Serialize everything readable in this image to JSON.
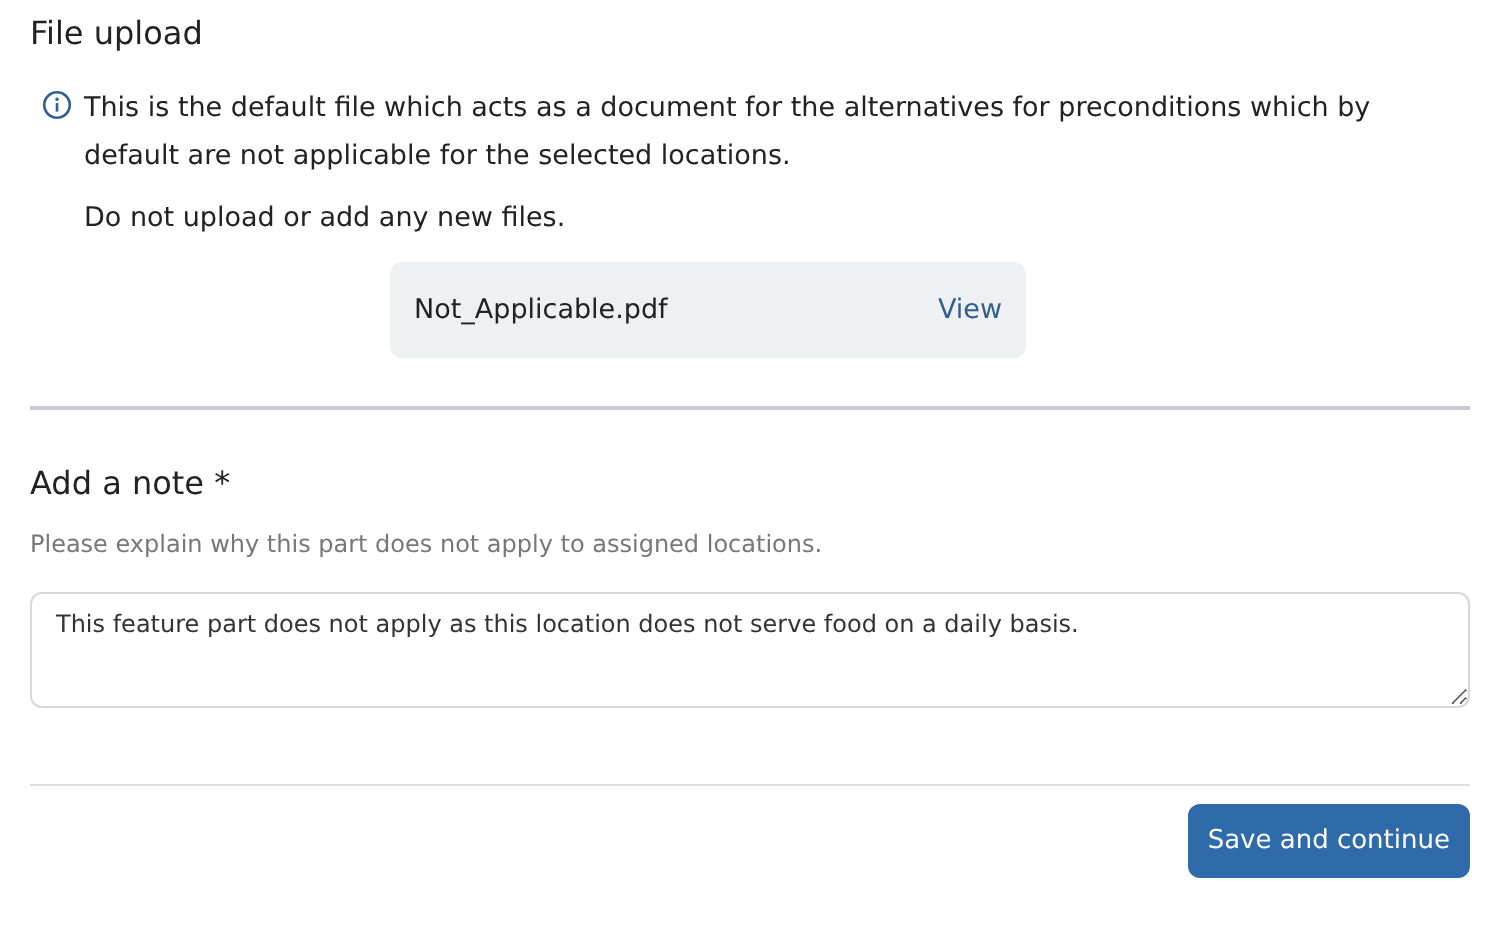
{
  "file_upload": {
    "title": "File upload",
    "info": "This is the default file which acts as a document for the alternatives for preconditions which by default are not applicable for the selected locations.",
    "warning": "Do not upload or add any new files.",
    "file": {
      "name": "Not_Applicable.pdf",
      "action": "View"
    }
  },
  "note": {
    "title": "Add a note *",
    "hint": "Please explain why this part does not apply to assigned locations.",
    "value": "This feature part does not apply as this location does not serve food on a daily basis."
  },
  "buttons": [
    "Save and continue"
  ]
}
